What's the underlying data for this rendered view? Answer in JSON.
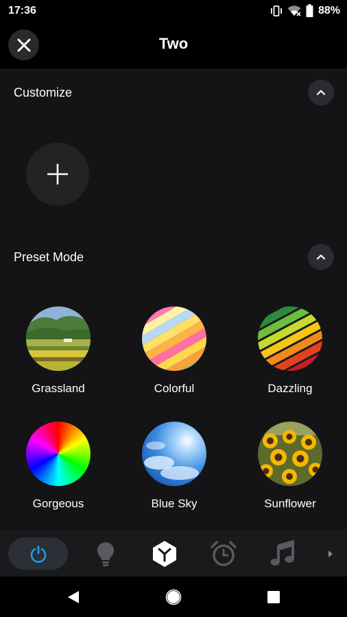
{
  "status": {
    "time": "17:36",
    "battery": "88%",
    "icons": [
      "vibrate-icon",
      "wifi-icon",
      "battery-icon"
    ]
  },
  "header": {
    "title": "Two",
    "close_icon": "close-icon"
  },
  "customize": {
    "title": "Customize",
    "collapse_icon": "chevron-up-icon",
    "add_icon": "plus-icon"
  },
  "preset": {
    "title": "Preset Mode",
    "collapse_icon": "chevron-up-icon",
    "items": [
      {
        "label": "Grassland",
        "image": "grassland-image"
      },
      {
        "label": "Colorful",
        "image": "colorful-stripes-image"
      },
      {
        "label": "Dazzling",
        "image": "dazzling-stripes-image"
      },
      {
        "label": "Gorgeous",
        "image": "color-wheel-image"
      },
      {
        "label": "Blue Sky",
        "image": "blue-sky-image"
      },
      {
        "label": "Sunflower",
        "image": "sunflower-image"
      }
    ]
  },
  "tabs": {
    "items": [
      "power-icon",
      "bulb-icon",
      "scene-cube-icon",
      "alarm-clock-icon",
      "music-note-icon",
      "more-arrow-icon"
    ],
    "active": "power-icon",
    "active_color": "#1e9be9",
    "selected_color": "#ffffff",
    "inactive_color": "#5a5a5e"
  },
  "nav": {
    "items": [
      "back-icon",
      "home-icon",
      "recents-icon"
    ]
  }
}
